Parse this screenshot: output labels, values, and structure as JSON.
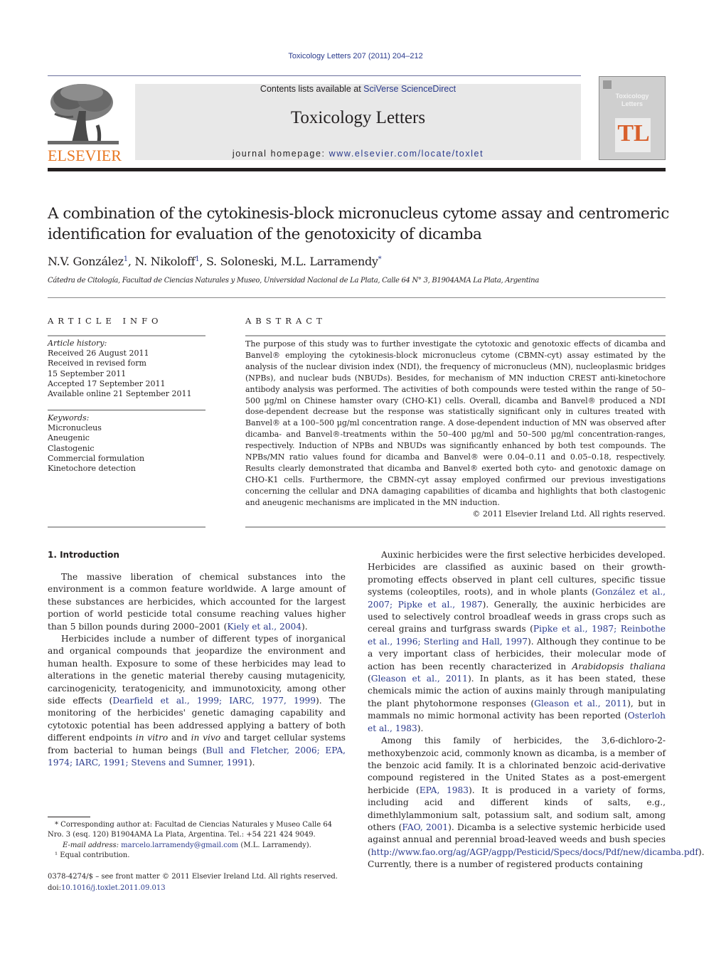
{
  "header": {
    "running_head": "Toxicology Letters 207 (2011) 204–212",
    "contents_prefix": "Contents lists available at ",
    "contents_link": "SciVerse ScienceDirect",
    "journal_name": "Toxicology Letters",
    "homepage_prefix": "journal homepage: ",
    "homepage_link": "www.elsevier.com/locate/toxlet",
    "publisher_logo_text": "ELSEVIER",
    "cover": {
      "title_line1": "Toxicology",
      "title_line2": "Letters",
      "monogram": "TL"
    },
    "colors": {
      "link": "#2a3a8c",
      "elsevier_orange": "#e87722",
      "masthead_bg": "#e8e8e8",
      "cover_tl": "#d8602c"
    }
  },
  "article": {
    "title": "A combination of the cytokinesis-block micronucleus cytome assay and centromeric identification for evaluation of the genotoxicity of dicamba",
    "authors": [
      {
        "name": "N.V. González",
        "mark": "1"
      },
      {
        "name": "N. Nikoloff",
        "mark": "1"
      },
      {
        "name": "S. Soloneski",
        "mark": ""
      },
      {
        "name": "M.L. Larramendy",
        "mark": "*"
      }
    ],
    "affiliation": "Cátedra de Citología, Facultad de Ciencias Naturales y Museo, Universidad Nacional de La Plata, Calle 64 N° 3, B1904AMA La Plata, Argentina"
  },
  "article_info": {
    "heading": "ARTICLE INFO",
    "history_label": "Article history:",
    "history": [
      "Received 26 August 2011",
      "Received in revised form",
      "15 September 2011",
      "Accepted 17 September 2011",
      "Available online 21 September 2011"
    ],
    "keywords_label": "Keywords:",
    "keywords": [
      "Micronucleus",
      "Aneugenic",
      "Clastogenic",
      "Commercial formulation",
      "Kinetochore detection"
    ]
  },
  "abstract": {
    "heading": "ABSTRACT",
    "text": "The purpose of this study was to further investigate the cytotoxic and genotoxic effects of dicamba and Banvel® employing the cytokinesis-block micronucleus cytome (CBMN-cyt) assay estimated by the analysis of the nuclear division index (NDI), the frequency of micronucleus (MN), nucleoplasmic bridges (NPBs), and nuclear buds (NBUDs). Besides, for mechanism of MN induction CREST anti-kinetochore antibody analysis was performed. The activities of both compounds were tested within the range of 50–500 µg/ml on Chinese hamster ovary (CHO-K1) cells. Overall, dicamba and Banvel® produced a NDI dose-dependent decrease but the response was statistically significant only in cultures treated with Banvel® at a 100–500 µg/ml concentration range. A dose-dependent induction of MN was observed after dicamba- and Banvel®-treatments within the 50–400 µg/ml and 50–500 µg/ml concentration-ranges, respectively. Induction of NPBs and NBUDs was significantly enhanced by both test compounds. The NPBs/MN ratio values found for dicamba and Banvel® were 0.04–0.11 and 0.05–0.18, respectively. Results clearly demonstrated that dicamba and Banvel® exerted both cyto- and genotoxic damage on CHO-K1 cells. Furthermore, the CBMN-cyt assay employed confirmed our previous investigations concerning the cellular and DNA damaging capabilities of dicamba and highlights that both clastogenic and aneugenic mechanisms are implicated in the MN induction.",
    "copyright": "© 2011 Elsevier Ireland Ltd. All rights reserved."
  },
  "introduction": {
    "heading": "1.  Introduction",
    "left_paragraphs": [
      [
        {
          "t": "The massive liberation of chemical substances into the environment is a common feature worldwide. A large amount of these substances are herbicides, which accounted for the largest portion of world pesticide total consume reaching values higher than 5 billon pounds during 2000–2001 ("
        },
        {
          "t": "Kiely et al., 2004",
          "ref": true
        },
        {
          "t": ")."
        }
      ],
      [
        {
          "t": "Herbicides include a number of different types of inorganical and organical compounds that jeopardize the environment and human health. Exposure to some of these herbicides may lead to alterations in the genetic material thereby causing mutagenicity, carcinogenicity, teratogenicity, and immunotoxicity, among other side effects ("
        },
        {
          "t": "Dearfield et al., 1999; IARC, 1977, 1999",
          "ref": true
        },
        {
          "t": "). The monitoring of the herbicides' genetic damaging capability and cytotoxic potential has been addressed applying a battery of both different endpoints "
        },
        {
          "t": "in vitro",
          "em": true
        },
        {
          "t": " and "
        },
        {
          "t": "in vivo",
          "em": true
        },
        {
          "t": " and target cellular systems from bacterial to human beings ("
        },
        {
          "t": "Bull and Fletcher, 2006; EPA, 1974; IARC, 1991; Stevens and Sumner, 1991",
          "ref": true
        },
        {
          "t": ")."
        }
      ]
    ],
    "right_paragraphs": [
      [
        {
          "t": "Auxinic herbicides were the first selective herbicides developed. Herbicides are classified as auxinic based on their growth-promoting effects observed in plant cell cultures, specific tissue systems (coleoptiles, roots), and in whole plants ("
        },
        {
          "t": "González et al., 2007; Pipke et al., 1987",
          "ref": true
        },
        {
          "t": "). Generally, the auxinic herbicides are used to selectively control broadleaf weeds in grass crops such as cereal grains and turfgrass swards ("
        },
        {
          "t": "Pipke et al., 1987; Reinbothe et al., 1996; Sterling and Hall, 1997",
          "ref": true
        },
        {
          "t": "). Although they continue to be a very important class of herbicides, their molecular mode of action has been recently characterized in "
        },
        {
          "t": "Arabidopsis thaliana",
          "em": true
        },
        {
          "t": " ("
        },
        {
          "t": "Gleason et al., 2011",
          "ref": true
        },
        {
          "t": "). In plants, as it has been stated, these chemicals mimic the action of auxins mainly through manipulating the plant phytohormone responses ("
        },
        {
          "t": "Gleason et al., 2011",
          "ref": true
        },
        {
          "t": "), but in mammals no mimic hormonal activity has been reported ("
        },
        {
          "t": "Osterloh et al., 1983",
          "ref": true
        },
        {
          "t": ")."
        }
      ],
      [
        {
          "t": "Among this family of herbicides, the 3,6-dichloro-2-methoxybenzoic acid, commonly known as dicamba, is a member of the benzoic acid family. It is a chlorinated benzoic acid-derivative compound registered in the United States as a post-emergent herbicide ("
        },
        {
          "t": "EPA, 1983",
          "ref": true
        },
        {
          "t": "). It is produced in a variety of forms, including acid and different kinds of salts, e.g., dimethlylammonium salt, potassium salt, and sodium salt, among others ("
        },
        {
          "t": "FAO, 2001",
          "ref": true
        },
        {
          "t": "). Dicamba is a selective systemic herbicide used against annual and perennial broad-leaved weeds and bush species ("
        },
        {
          "t": "http://www.fao.org/ag/AGP/agpp/Pesticid/Specs/docs/Pdf/new/dicamba.pdf",
          "ref": true
        },
        {
          "t": "). Currently, there is a number of registered products containing"
        }
      ]
    ]
  },
  "footnotes": {
    "corresponding": "* Corresponding author at: Facultad de Ciencias Naturales y Museo Calle 64 Nro. 3 (esq. 120) B1904AMA La Plata, Argentina. Tel.: +54 221 424 9049.",
    "email_label": "E-mail address: ",
    "email": "marcelo.larramendy@gmail.com",
    "email_suffix": " (M.L. Larramendy).",
    "equal_contribution": "¹  Equal contribution."
  },
  "front_matter": {
    "issn_line": "0378-4274/$ – see front matter © 2011 Elsevier Ireland Ltd. All rights reserved.",
    "doi_prefix": "doi:",
    "doi": "10.1016/j.toxlet.2011.09.013"
  }
}
